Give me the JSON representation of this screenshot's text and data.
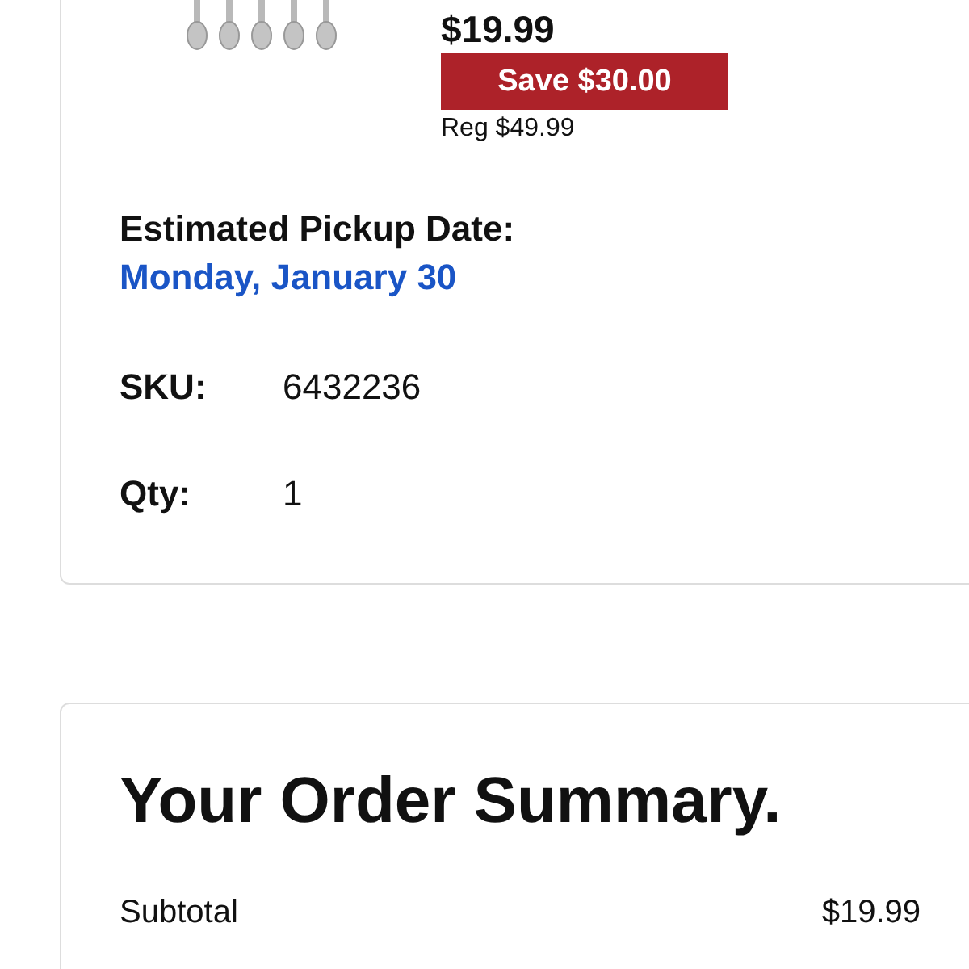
{
  "item": {
    "price": "$19.99",
    "savings": "Save $30.00",
    "regular_price": "Reg $49.99",
    "pickup_label": "Estimated Pickup Date:",
    "pickup_date": "Monday, January 30",
    "details": [
      {
        "label": "SKU:",
        "value": "6432236"
      },
      {
        "label": "Qty:",
        "value": "1"
      }
    ]
  },
  "order_summary": {
    "title": "Your Order Summary.",
    "rows": [
      {
        "label": "Subtotal",
        "value": "$19.99"
      }
    ]
  }
}
